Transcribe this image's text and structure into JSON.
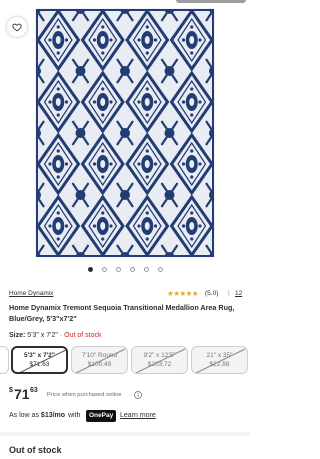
{
  "gallery": {
    "favorite_icon": "heart-icon",
    "dot_count": 6,
    "active_dot": 0,
    "colors": {
      "navy": "#223c74",
      "ground": "#e9ecf2"
    }
  },
  "product": {
    "brand": "Home Dynamix",
    "rating_stars": "★★★★★",
    "rating_value": "(5.0)",
    "separator": "|",
    "review_count": "12",
    "title": "Home Dynamix Tremont Sequoia Transitional Medallion Area Rug, Blue/Grey, 5'3\"x7'2\""
  },
  "size": {
    "label": "Size:",
    "value": "5'3\" x 7'2\"",
    "status": "Out of stock",
    "status_color": "#c62828",
    "options": [
      {
        "size": "5'3\" x 7'2\"",
        "price": "$71.63",
        "selected": true
      },
      {
        "size": "7'10\" Round",
        "price": "$100.49",
        "selected": false
      },
      {
        "size": "9'2\" x 12'5\"",
        "price": "$203.72",
        "selected": false
      },
      {
        "size": "21\" x 35\"",
        "price": "$22.88",
        "selected": false
      }
    ]
  },
  "price": {
    "currency": "$",
    "whole": "71",
    "cents": "63",
    "note": "Price when purchased online"
  },
  "onepay": {
    "prefix": "As low as",
    "amount": "$13/mo",
    "with": "with",
    "badge": "OnePay",
    "learn_more": "Learn more"
  },
  "stock": {
    "heading": "Out of stock"
  }
}
